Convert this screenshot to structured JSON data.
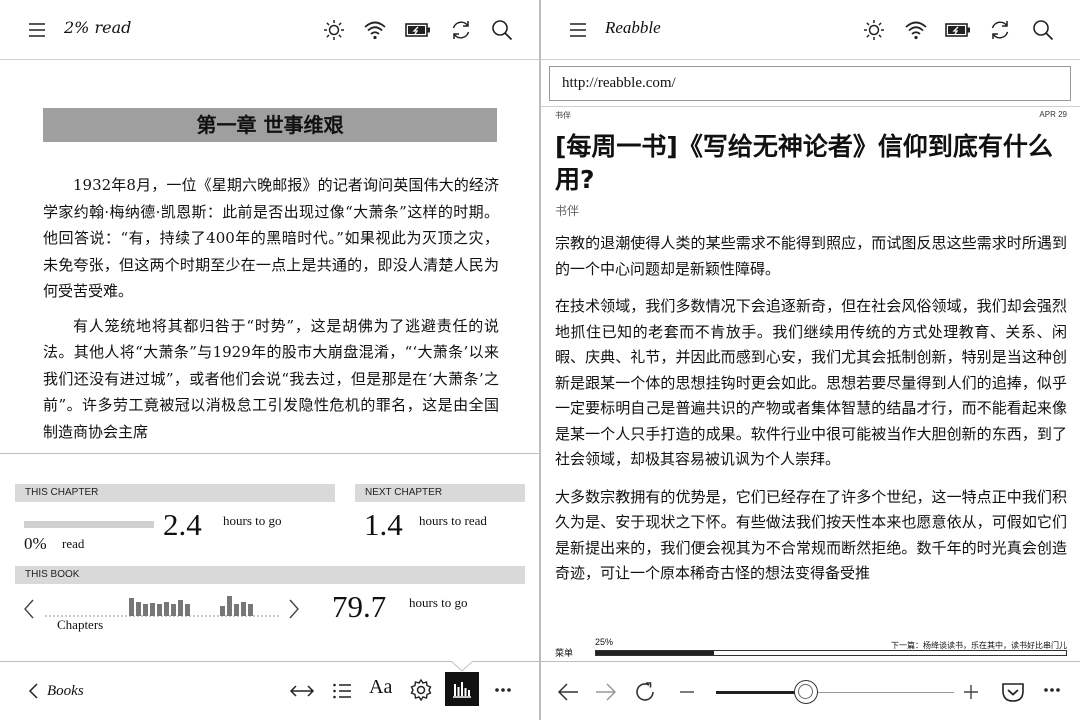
{
  "left": {
    "header": {
      "title": "2% read"
    },
    "chapter_heading": "第一章 世事维艰",
    "paragraphs": [
      "1932年8月，一位《星期六晚邮报》的记者询问英国伟大的经济学家约翰·梅纳德·凯恩斯：此前是否出现过像“大萧条”这样的时期。他回答说：“有，持续了400年的黑暗时代。”如果视此为灭顶之灾，未免夸张，但这两个时期至少在一点上是共通的，即没人清楚人民为何受苦受难。",
      "有人笼统地将其都归咎于“时势”，这是胡佛为了逃避责任的说法。其他人将“大萧条”与1929年的股市大崩盘混淆，“‘大萧条’以来我们还没有进过城”，或者他们会说“我去过，但是那是在‘大萧条’之前”。许多劳工竟被冠以消极怠工引发隐性危机的罪名，这是由全国制造商协会主席"
    ],
    "stats": {
      "this_chapter_label": "THIS CHAPTER",
      "chapter_read_pct": "0%",
      "chapter_read_label": "read",
      "chapter_progress": 0,
      "chapter_hours": "2.4",
      "chapter_hours_label": "hours to go",
      "next_chapter_label": "NEXT CHAPTER",
      "next_hours": "1.4",
      "next_hours_label": "hours to read",
      "this_book_label": "THIS BOOK",
      "chapters_label": "Chapters",
      "book_hours": "79.7",
      "book_hours_label": "hours to go",
      "chapter_bars": [
        18,
        14,
        12,
        13,
        12,
        14,
        12,
        16,
        12,
        0,
        0,
        0,
        0,
        10,
        20,
        12,
        14,
        12
      ]
    },
    "bottom": {
      "back_label": "Books",
      "font_label": "Aa"
    }
  },
  "right": {
    "header": {
      "title": "Reabble"
    },
    "url": "http://reabble.com/",
    "article": {
      "tag": "书伴",
      "date": "APR 29",
      "title": "[每周一书]《写给无神论者》信仰到底有什么用?",
      "source": "书伴",
      "paragraphs": [
        "宗教的退潮使得人类的某些需求不能得到照应，而试图反思这些需求时所遇到的一个中心问题却是新颖性障碍。",
        "在技术领域，我们多数情况下会追逐新奇，但在社会风俗领域，我们却会强烈地抓住已知的老套而不肯放手。我们继续用传统的方式处理教育、关系、闲暇、庆典、礼节，并因此而感到心安，我们尤其会抵制创新，特别是当这种创新是跟某一个体的思想挂钩时更会如此。思想若要尽量得到人们的追捧，似乎一定要标明自己是普遍共识的产物或者集体智慧的结晶才行，而不能看起来像是某一个人只手打造的成果。软件行业中很可能被当作大胆创新的东西，到了社会领域，却极其容易被讥讽为个人崇拜。",
        "大多数宗教拥有的优势是，它们已经存在了许多个世纪，这一特点正中我们积久为是、安于现状之下怀。有些做法我们按天性本来也愿意依从，可假如它们是新提出来的，我们便会视其为不合常规而断然拒绝。数千年的时光真会创造奇迹，可让一个原本稀奇古怪的想法变得备受推"
      ]
    },
    "footer": {
      "menu_label": "菜单",
      "progress_pct": "25%",
      "progress": 0.25,
      "next_link": "下一篇：杨绛谈读书，乐在其中，读书好比串门儿"
    },
    "zoom_level": 0.38
  }
}
